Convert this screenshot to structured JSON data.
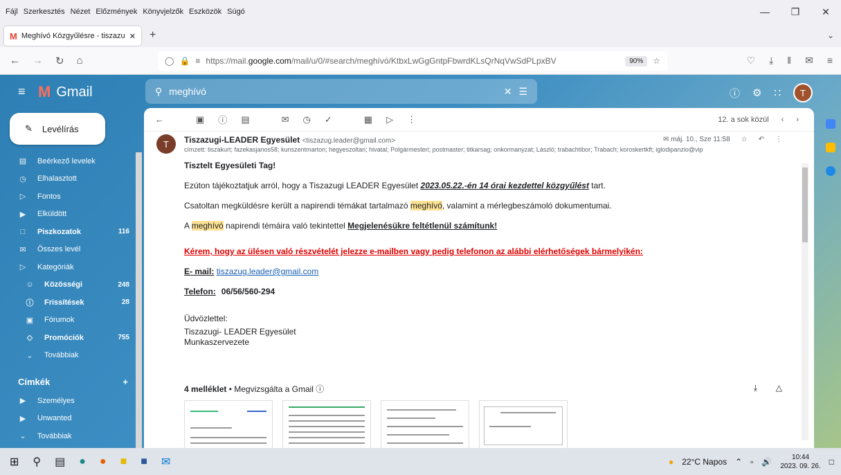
{
  "browser": {
    "menu": [
      "Fájl",
      "Szerkesztés",
      "Nézet",
      "Előzmények",
      "Könyvjelzők",
      "Eszközök",
      "Súgó"
    ],
    "tab_title": "Meghívó Közgyűlésre - tiszazug",
    "url_prefix": "https://mail.",
    "url_domain": "google.com",
    "url_rest": "/mail/u/0/#search/meghívó/KtbxLwGgGntpFbwrdKLsQrNqVwSdPLpxBV",
    "zoom": "90%"
  },
  "gmail": {
    "brand": "Gmail",
    "search_query": "meghívó",
    "avatar": "T",
    "compose": "Levélírás",
    "sidebar": [
      {
        "label": "Beérkező levelek",
        "icon": "inbox-icon",
        "count": ""
      },
      {
        "label": "Elhalasztott",
        "icon": "clock-icon",
        "count": ""
      },
      {
        "label": "Fontos",
        "icon": "important-icon",
        "count": ""
      },
      {
        "label": "Elküldött",
        "icon": "send-icon",
        "count": ""
      },
      {
        "label": "Piszkozatok",
        "icon": "draft-icon",
        "count": "116"
      },
      {
        "label": "Összes levél",
        "icon": "all-mail-icon",
        "count": ""
      },
      {
        "label": "Kategóriák",
        "icon": "label-icon",
        "count": ""
      },
      {
        "label": "Közösségi",
        "icon": "people-icon",
        "count": "248"
      },
      {
        "label": "Frissítések",
        "icon": "info-icon",
        "count": "28"
      },
      {
        "label": "Fórumok",
        "icon": "forum-icon",
        "count": ""
      },
      {
        "label": "Promóciók",
        "icon": "tag-icon",
        "count": "755"
      },
      {
        "label": "Továbbiak",
        "icon": "chevron-down-icon",
        "count": ""
      }
    ],
    "labels_header": "Címkék",
    "labels": [
      {
        "label": "Személyes",
        "icon": "label-icon"
      },
      {
        "label": "Unwanted",
        "icon": "label-icon"
      },
      {
        "label": "Továbbiak",
        "icon": "chevron-down-icon"
      }
    ],
    "pager": "12. a sok közül"
  },
  "email": {
    "sender_initial": "T",
    "sender_name": "Tiszazugi-LEADER Egyesület",
    "sender_addr": "<tiszazug.leader@gmail.com>",
    "recipients": "címzett: tiszakurt; fazekasjanos58; kunszentmarton; hegyeszoltan; hivatal; Polgármesteri; postmaster; titkarsag; onkormanyzat; László; trabachtibor; Trabach; koroskertkft; iglodipanzio@vip",
    "date": "máj. 10., Sze 11:58",
    "greeting": "Tisztelt Egyesületi Tag!",
    "p1_a": "Ezúton tájékoztatjuk arról, hogy a Tiszazugi LEADER Egyesület ",
    "p1_b": "2023.05.22.-én 14 órai kezdettel  közgyűlést",
    "p1_c": " tart.",
    "p2_a": "Csatoltan megküldésre került a napirendi témákat tartalmazó ",
    "p2_hl": "meghívó",
    "p2_b": ", valamint a mérlegbeszámoló dokumentumai.",
    "p3_a": "A ",
    "p3_hl": "meghívó",
    "p3_b": " napirendi témáira való tekintettel ",
    "p3_c": "Megjelenésükre feltétlenül számítunk!",
    "red_line": "Kérem, hogy az ülésen való részvételét jelezze e-mailben vagy pedig telefonon az alábbi elérhetőségek bármelyikén:",
    "email_label": "E- mail:",
    "email_value": "tiszazug.leader@gmail.com",
    "phone_label": "Telefon:",
    "phone_value": "06/56/560-294",
    "closing": "Üdvözlettel:",
    "sig1": "Tiszazugi- LEADER Egyesület",
    "sig2": "Munkaszervezete",
    "attach_count": "4 melléklet",
    "attach_scan": " • Megvizsgálta a Gmail"
  },
  "taskbar": {
    "weather": "22°C  Napos",
    "time": "10:44",
    "date": "2023. 09. 26."
  }
}
